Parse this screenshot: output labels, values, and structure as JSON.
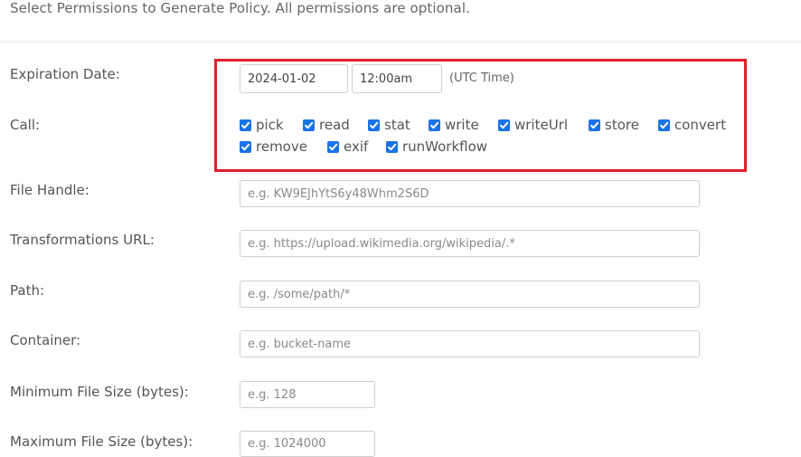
{
  "intro_text": "Select Permissions to Generate Policy. All permissions are optional.",
  "expiration": {
    "label": "Expiration Date:",
    "date_value": "2024-01-02",
    "time_value": "12:00am",
    "timezone_note": "(UTC Time)"
  },
  "call": {
    "label": "Call:",
    "options": [
      {
        "label": "pick",
        "checked": true
      },
      {
        "label": "read",
        "checked": true
      },
      {
        "label": "stat",
        "checked": true
      },
      {
        "label": "write",
        "checked": true
      },
      {
        "label": "writeUrl",
        "checked": true
      },
      {
        "label": "store",
        "checked": true
      },
      {
        "label": "convert",
        "checked": true
      },
      {
        "label": "remove",
        "checked": true
      },
      {
        "label": "exif",
        "checked": true
      },
      {
        "label": "runWorkflow",
        "checked": true
      }
    ]
  },
  "file_handle": {
    "label": "File Handle:",
    "placeholder": "e.g. KW9EJhYtS6y48Whm2S6D"
  },
  "transformations_url": {
    "label": "Transformations URL:",
    "placeholder": "e.g. https://upload.wikimedia.org/wikipedia/.*"
  },
  "path": {
    "label": "Path:",
    "placeholder": "e.g. /some/path/*"
  },
  "container": {
    "label": "Container:",
    "placeholder": "e.g. bucket-name"
  },
  "min_size": {
    "label": "Minimum File Size (bytes):",
    "placeholder": "e.g. 128"
  },
  "max_size": {
    "label": "Maximum File Size (bytes):",
    "placeholder": "e.g. 1024000"
  },
  "colors": {
    "checkbox": "#1a73e8",
    "highlight": "#e0202a"
  }
}
